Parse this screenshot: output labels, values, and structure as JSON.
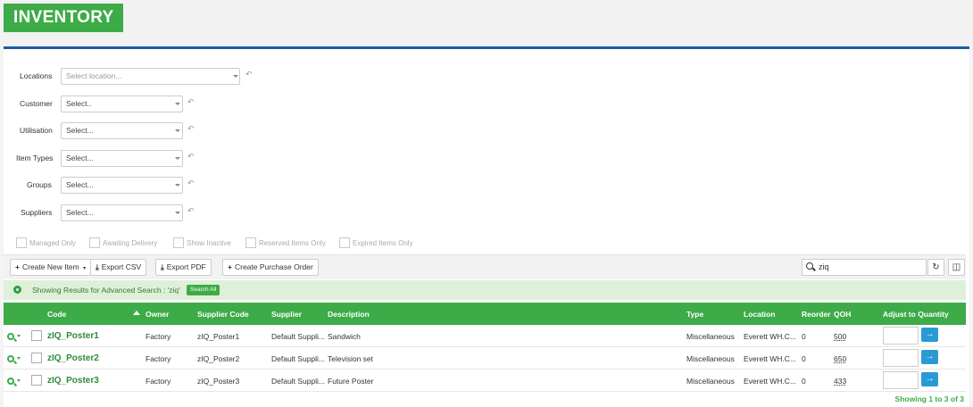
{
  "title": "INVENTORY",
  "filters": [
    {
      "label": "Locations",
      "value": "Select location...",
      "placeholder": true
    },
    {
      "label": "Customer",
      "value": "Select..",
      "placeholder": false
    },
    {
      "label": "Utilisation",
      "value": "Select...",
      "placeholder": false
    },
    {
      "label": "Item Types",
      "value": "Select...",
      "placeholder": false
    },
    {
      "label": "Groups",
      "value": "Select...",
      "placeholder": false
    },
    {
      "label": "Suppliers",
      "value": "Select...",
      "placeholder": false
    }
  ],
  "checkboxes": [
    "Managed Only",
    "Awaiting Delivery",
    "Show Inactive",
    "Reserved Items Only",
    "Expired Items Only"
  ],
  "toolbar": {
    "create_new": "Create New Item",
    "export_csv": "Export CSV",
    "export_pdf": "Export PDF",
    "create_po": "Create Purchase Order",
    "search_value": "ziq"
  },
  "results": {
    "text": "Showing Results for Advanced Search : 'ziq'",
    "search_all": "Search All"
  },
  "columns": [
    "Code",
    "Owner",
    "Supplier Code",
    "Supplier",
    "Description",
    "Type",
    "Location",
    "Reorder",
    "QOH",
    "Adjust to Quantity"
  ],
  "rows": [
    {
      "code": "zIQ_Poster1",
      "owner": "Factory",
      "supplier_code": "zIQ_Poster1",
      "supplier": "Default Suppli...",
      "description": "Sandwich",
      "type": "Miscellaneous",
      "location": "Everett WH.C...",
      "reorder": "0",
      "qoh": "500"
    },
    {
      "code": "zIQ_Poster2",
      "owner": "Factory",
      "supplier_code": "zIQ_Poster2",
      "supplier": "Default Suppli...",
      "description": "Television set",
      "type": "Miscellaneous",
      "location": "Everett WH.C...",
      "reorder": "0",
      "qoh": "650"
    },
    {
      "code": "zIQ_Poster3",
      "owner": "Factory",
      "supplier_code": "zIQ_Poster3",
      "supplier": "Default Suppli...",
      "description": "Future Poster",
      "type": "Miscellaneous",
      "location": "Everett WH.C...",
      "reorder": "0",
      "qoh": "433"
    }
  ],
  "footer": "Showing 1 to 3 of 3"
}
